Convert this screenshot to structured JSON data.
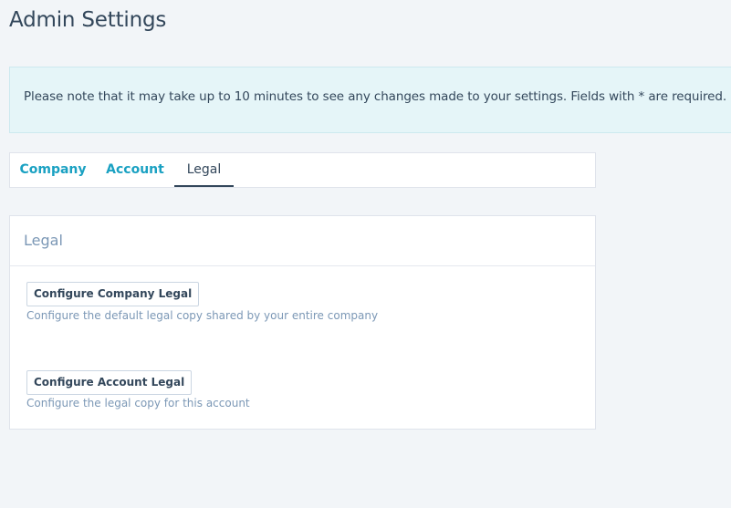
{
  "page": {
    "title": "Admin Settings"
  },
  "notice": {
    "text": "Please note that it may take up to 10 minutes to see any changes made to your settings. Fields with * are required."
  },
  "tabs": [
    {
      "label": "Company",
      "active": false
    },
    {
      "label": "Account",
      "active": false
    },
    {
      "label": "Legal",
      "active": true
    }
  ],
  "legal_panel": {
    "title": "Legal",
    "company_button_label": "Configure Company Legal",
    "company_help": "Configure the default legal copy shared by your entire company",
    "account_button_label": "Configure Account Legal",
    "account_help": "Configure the legal copy for this account"
  },
  "colors": {
    "background": "#f2f5f8",
    "notice_bg": "#e5f5f8",
    "tab_link": "#1aa1c2",
    "text": "#33475b",
    "muted": "#7c98b6"
  }
}
